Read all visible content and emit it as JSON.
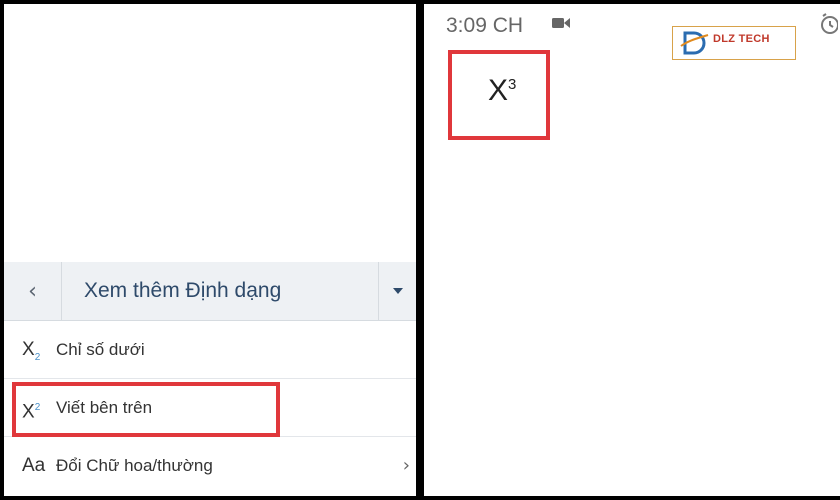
{
  "format_menu": {
    "title": "Xem thêm Định dạng",
    "items": [
      {
        "icon_base": "X",
        "icon_index": "2",
        "label": "Chỉ số dưới"
      },
      {
        "icon_base": "X",
        "icon_index": "2",
        "label": "Viết bên trên"
      },
      {
        "icon_text": "Aa",
        "label": "Đổi Chữ hoa/thường"
      }
    ]
  },
  "status_bar": {
    "time": "3:09 CH"
  },
  "logo": {
    "text": "DLZ TECH"
  },
  "result": {
    "base": "X",
    "exponent": "3"
  },
  "colors": {
    "highlight": "#e0373b",
    "menu_title": "#2e4a6a",
    "header_bg": "#eef1f4"
  },
  "icons": {
    "back": "chevron-left-icon",
    "dropdown": "caret-down-icon",
    "submenu": "chevron-right-icon",
    "video": "video-camera-icon",
    "alarm": "alarm-clock-icon"
  }
}
